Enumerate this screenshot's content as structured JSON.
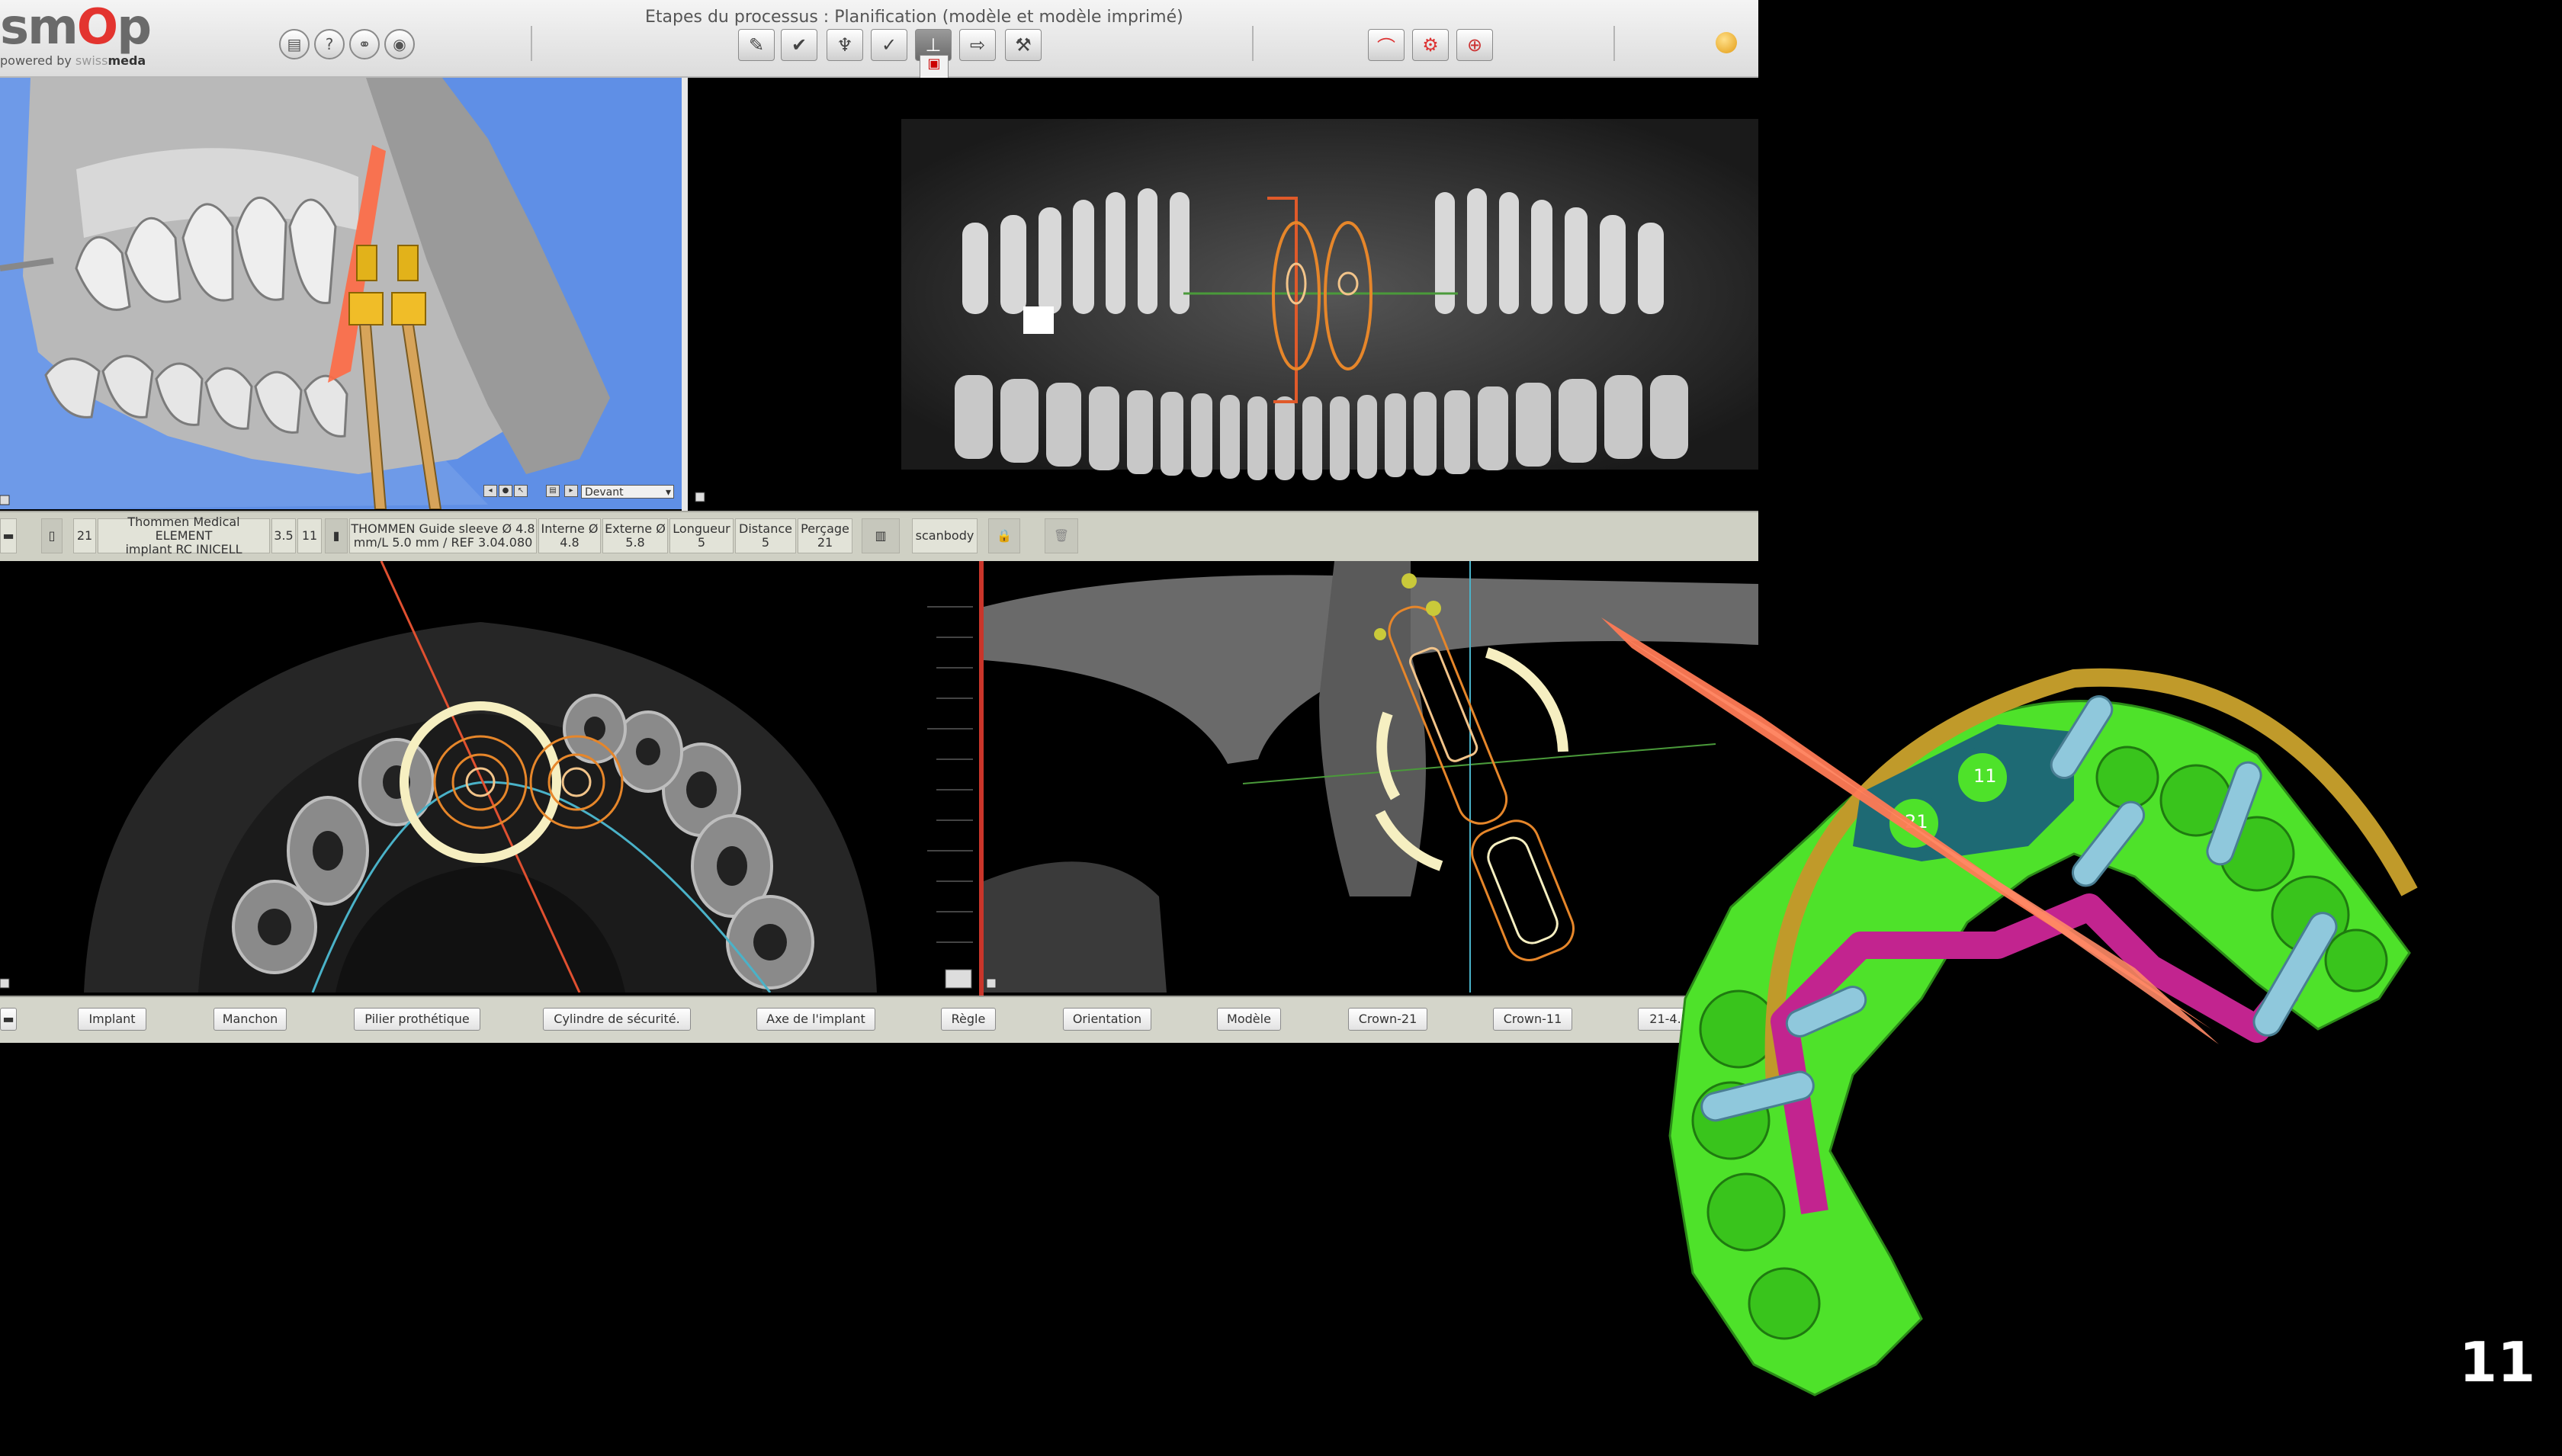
{
  "header": {
    "logo_text_a": "sm",
    "logo_text_b": "O",
    "logo_text_c": "p",
    "tagline_a": "powered by ",
    "tagline_b": "swiss",
    "tagline_c": "meda",
    "process_title": "Etapes du processus : Planification (modèle et modèle imprimé)"
  },
  "view3d": {
    "orientation_value": "Devant"
  },
  "infobar": {
    "tooth": "21",
    "implant_line1": "Thommen Medical ELEMENT",
    "implant_line2": "implant RC INICELL",
    "diameter": "3.5",
    "length": "11",
    "sleeve_line1": "THOMMEN Guide sleeve Ø 4.8",
    "sleeve_line2": "mm/L 5.0 mm / REF 3.04.080",
    "interne_label": "Interne Ø",
    "interne_value": "4.8",
    "externe_label": "Externe Ø",
    "externe_value": "5.8",
    "longueur_label": "Longueur",
    "longueur_value": "5",
    "distance_label": "Distance",
    "distance_value": "5",
    "percage_label": "Perçage",
    "percage_value": "21",
    "scanbody_label": "scanbody"
  },
  "bottom_buttons": {
    "implant": "Implant",
    "manchon": "Manchon",
    "pilier": "Pilier prothétique",
    "cylindre": "Cylindre de sécurité.",
    "axe": "Axe de l'implant",
    "regle": "Règle",
    "orientation": "Orientation",
    "modele": "Modèle",
    "crown21": "Crown-21",
    "crown11": "Crown-11",
    "version": "21-4.23.114"
  },
  "guide": {
    "label_11": "11",
    "label_21": "21"
  },
  "slide": {
    "number": "11"
  },
  "colors": {
    "sky_blue": "#5f8fe6",
    "plane_orange": "#ff7a55",
    "model_green": "#4ee22a",
    "guide_magenta": "#c2248f",
    "sleeve_blue": "#8fc8dc",
    "ring_cream": "#f6efc1"
  }
}
